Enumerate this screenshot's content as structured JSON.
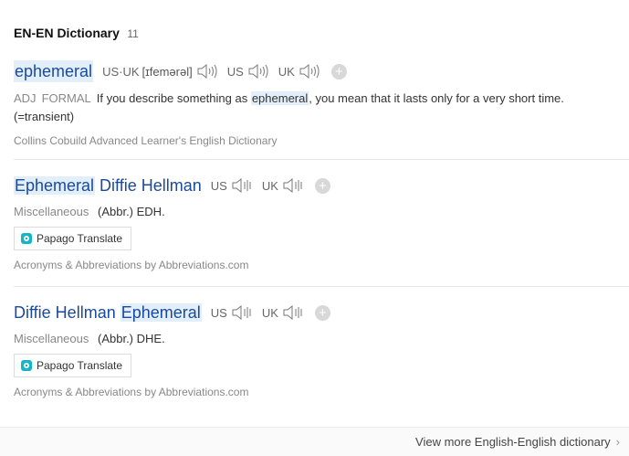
{
  "section": {
    "title": "EN-EN Dictionary",
    "count": "11"
  },
  "entry1": {
    "word": "ephemeral",
    "pron1_label": "US·UK",
    "phonetic": "[ɪfemərəl]",
    "pron2_label": "US",
    "pron3_label": "UK",
    "pos": "ADJ",
    "register": "FORMAL",
    "definition_before": "If you describe something as ",
    "definition_highlight": "ephemeral",
    "definition_after": ", you mean that it lasts only for a very short time. (=transient)",
    "source": "Collins Cobuild Advanced Learner's English Dictionary"
  },
  "entry2": {
    "word_highlight": "Ephemeral",
    "word_rest": " Diffie Hellman",
    "us_label": "US",
    "uk_label": "UK",
    "category": "Miscellaneous",
    "abbr": "(Abbr.) EDH.",
    "papago": "Papago Translate",
    "source": "Acronyms & Abbreviations by Abbreviations.com"
  },
  "entry3": {
    "word_rest": "Diffie Hellman ",
    "word_highlight": "Ephemeral",
    "us_label": "US",
    "uk_label": "UK",
    "category": "Miscellaneous",
    "abbr": "(Abbr.) DHE.",
    "papago": "Papago Translate",
    "source": "Acronyms & Abbreviations by Abbreviations.com"
  },
  "footer": {
    "view_more": "View more English-English dictionary"
  },
  "colors": {
    "link": "#1a4a9c",
    "highlight": "#e2effa",
    "papago": "#13b6c6"
  }
}
